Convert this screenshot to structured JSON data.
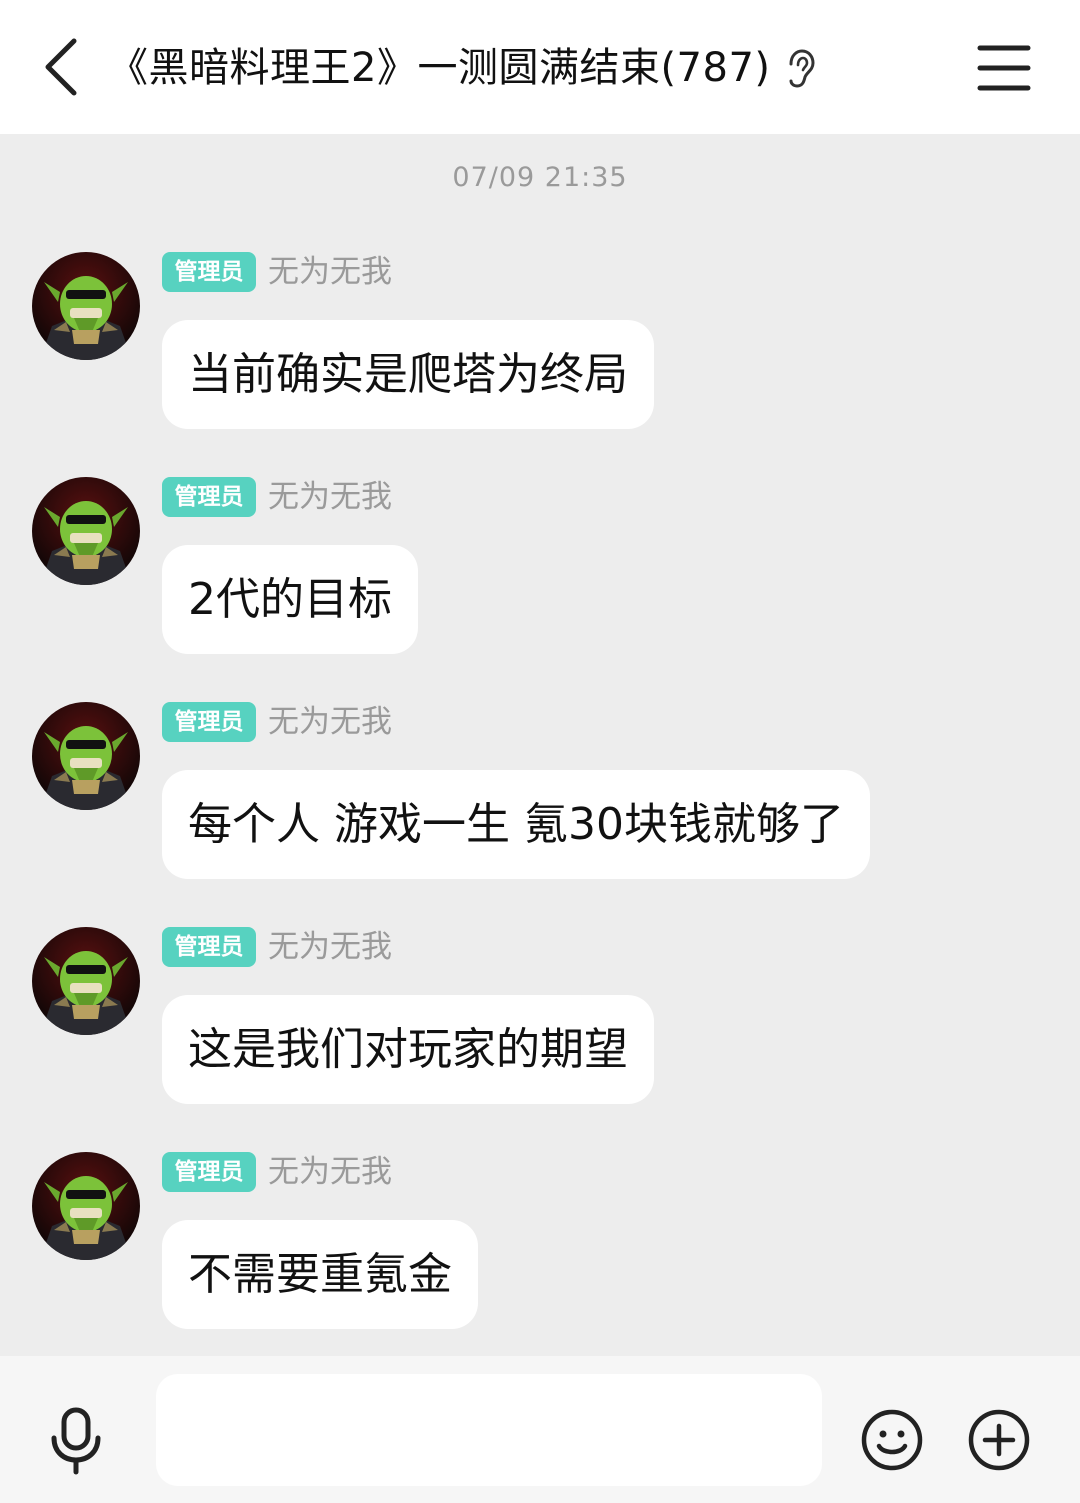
{
  "header": {
    "title": "《黑暗料理王2》一测圆满结束(787)",
    "back_icon": "chevron-left-icon",
    "listen_icon": "ear-icon",
    "menu_icon": "hamburger-menu-icon"
  },
  "chat": {
    "timestamp": "07/09 21:35",
    "messages": [
      {
        "badge": "管理员",
        "sender": "无为无我",
        "text": "当前确实是爬塔为终局"
      },
      {
        "badge": "管理员",
        "sender": "无为无我",
        "text": "2代的目标"
      },
      {
        "badge": "管理员",
        "sender": "无为无我",
        "text": "每个人 游戏一生 氪30块钱就够了"
      },
      {
        "badge": "管理员",
        "sender": "无为无我",
        "text": "这是我们对玩家的期望"
      },
      {
        "badge": "管理员",
        "sender": "无为无我",
        "text": "不需要重氪金"
      }
    ]
  },
  "footer": {
    "input_value": "",
    "mic_icon": "microphone-icon",
    "emoji_icon": "smiley-icon",
    "plus_icon": "plus-circle-icon"
  },
  "colors": {
    "badge": "#57d2c0",
    "background": "#ededed",
    "bubble": "#ffffff"
  }
}
